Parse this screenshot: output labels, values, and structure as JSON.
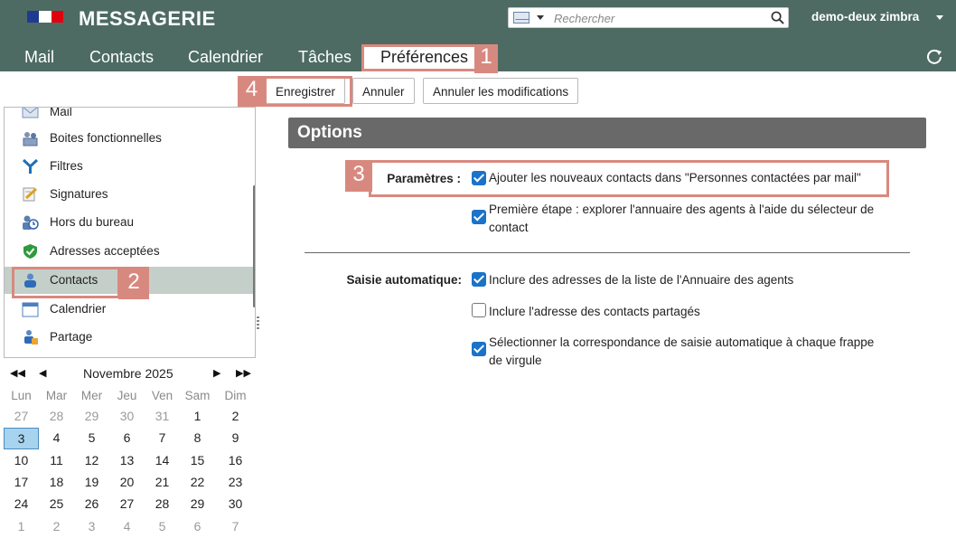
{
  "colors": {
    "header_bg": "#4d6b63",
    "accent": "#1a73c9",
    "options_bar": "#696969",
    "annotation": "#d8897f",
    "selected_row": "#c4cfc9"
  },
  "header": {
    "title": "MESSAGERIE",
    "search_placeholder": "Rechercher",
    "user": "demo-deux zimbra"
  },
  "nav": {
    "tabs": [
      "Mail",
      "Contacts",
      "Calendrier",
      "Tâches",
      "Préférences"
    ],
    "active": "Préférences"
  },
  "toolbar": {
    "save": "Enregistrer",
    "cancel": "Annuler",
    "revert": "Annuler les modifications"
  },
  "sidebar": {
    "items": [
      {
        "label": "Mail",
        "icon": "mail-icon"
      },
      {
        "label": "Boites fonctionnelles",
        "icon": "shared-mailbox-icon"
      },
      {
        "label": "Filtres",
        "icon": "filter-icon"
      },
      {
        "label": "Signatures",
        "icon": "signature-icon"
      },
      {
        "label": "Hors du bureau",
        "icon": "out-of-office-icon"
      },
      {
        "label": "Adresses acceptées",
        "icon": "shield-check-icon"
      },
      {
        "label": "Contacts",
        "icon": "contact-icon"
      },
      {
        "label": "Calendrier",
        "icon": "calendar-icon"
      },
      {
        "label": "Partage",
        "icon": "sharing-icon"
      }
    ],
    "selected": "Contacts"
  },
  "calendar": {
    "month": "Novembre 2025",
    "days_of_week": [
      "Lun",
      "Mar",
      "Mer",
      "Jeu",
      "Ven",
      "Sam",
      "Dim"
    ],
    "weeks": [
      [
        "27",
        "28",
        "29",
        "30",
        "31",
        "1",
        "2"
      ],
      [
        "3",
        "4",
        "5",
        "6",
        "7",
        "8",
        "9"
      ],
      [
        "10",
        "11",
        "12",
        "13",
        "14",
        "15",
        "16"
      ],
      [
        "17",
        "18",
        "19",
        "20",
        "21",
        "22",
        "23"
      ],
      [
        "24",
        "25",
        "26",
        "27",
        "28",
        "29",
        "30"
      ],
      [
        "1",
        "2",
        "3",
        "4",
        "5",
        "6",
        "7"
      ]
    ],
    "today": "3"
  },
  "options": {
    "title": "Options",
    "parametres_label": "Paramètres :",
    "param_add_contacts": "Ajouter les nouveaux contacts dans \"Personnes contactées par mail\"",
    "param_first_step_line1": "Première étape : explorer l'annuaire des agents à l'aide du sélecteur de",
    "param_first_step_line2": "contact",
    "saisie_label": "Saisie automatique:",
    "auto_include_directory": "Inclure des adresses de la liste de l'Annuaire des agents",
    "auto_include_shared": "Inclure l'adresse des contacts partagés",
    "auto_select_line1": "Sélectionner la correspondance de saisie automatique à chaque frappe",
    "auto_select_line2": "de virgule",
    "checked": {
      "add_contacts": true,
      "first_step": true,
      "include_directory": true,
      "include_shared": false,
      "select_match": true
    }
  },
  "annotations": {
    "n1": "1",
    "n2": "2",
    "n3": "3",
    "n4": "4"
  }
}
